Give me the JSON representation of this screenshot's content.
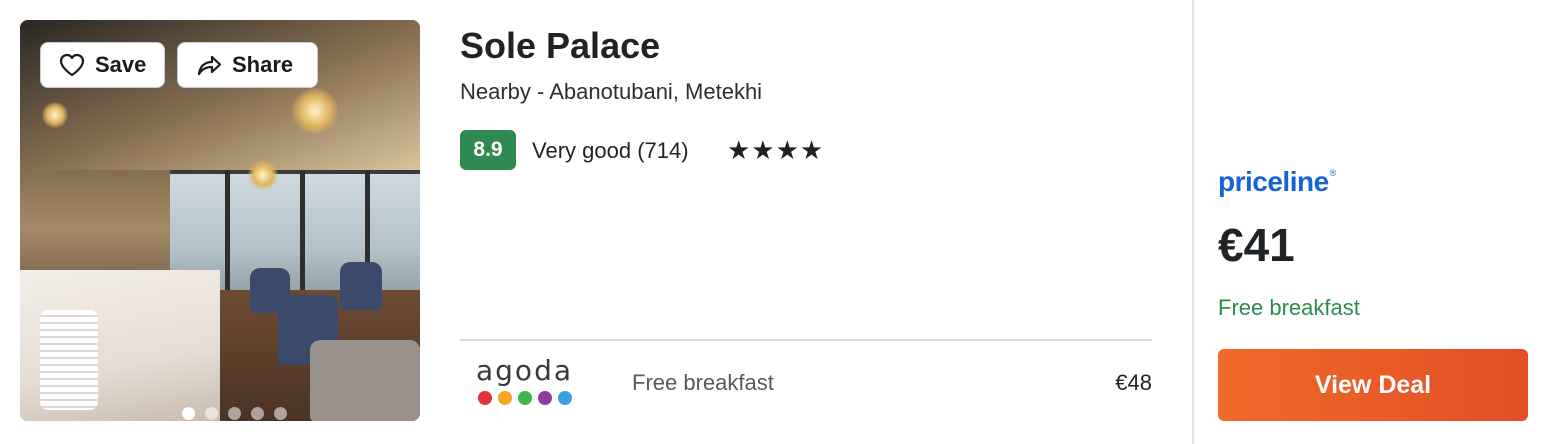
{
  "hotel": {
    "name": "Sole Palace",
    "location": "Nearby - Abanotubani, Metekhi",
    "rating_score": "8.9",
    "rating_text": "Very good (714)",
    "stars": "★★★★",
    "star_count": 4
  },
  "photo": {
    "save_label": "Save",
    "share_label": "Share",
    "slide_count": 5,
    "active_slide": 1
  },
  "alt_offer": {
    "provider": "agoda",
    "perk": "Free breakfast",
    "price": "€48",
    "dot_colors": [
      "#e0323a",
      "#f6a623",
      "#41b649",
      "#8e3d9c",
      "#3aa2e4"
    ]
  },
  "best_offer": {
    "provider": "priceline",
    "price": "€41",
    "perk": "Free breakfast",
    "cta_label": "View Deal"
  },
  "colors": {
    "rating_badge": "#2f8a4f",
    "perk_green": "#2f8a4f",
    "priceline_blue": "#1463d8",
    "cta_orange": "#f06a2a"
  }
}
